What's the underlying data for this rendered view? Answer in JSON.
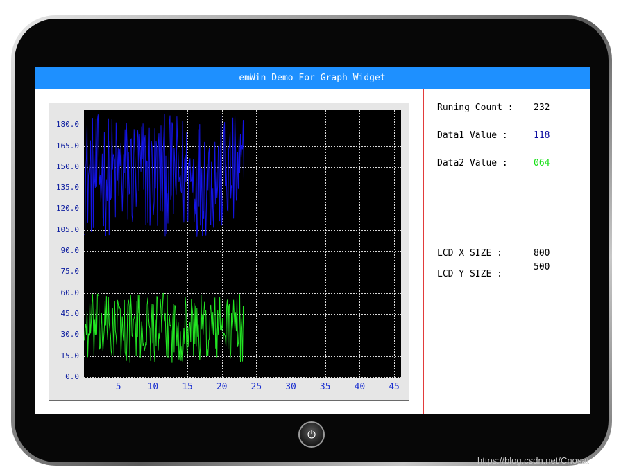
{
  "window": {
    "title": "emWin Demo For Graph Widget"
  },
  "info": {
    "running_count_label": "Runing Count :",
    "running_count_value": "232",
    "data1_label": "Data1 Value  :",
    "data1_value": "118",
    "data2_label": "Data2 Value  :",
    "data2_value": "064",
    "lcd_x_label": "LCD X SIZE :",
    "lcd_x_value": "800",
    "lcd_y_label": "LCD Y SIZE :",
    "lcd_y_value": "500"
  },
  "home_button": {
    "icon": "power-icon",
    "glyph": "⏻"
  },
  "watermark": "https://blog.csdn.net/Cnosat",
  "colors": {
    "title_bar": "#1e90ff",
    "series1": "#1414e6",
    "series2": "#23e623",
    "divider": "#e23b3b",
    "y_tick": "#1020a0",
    "x_tick": "#1a2fd0",
    "data1_value": "#0a0aa0",
    "data2_value": "#16e016"
  },
  "chart_data": {
    "type": "line",
    "x_ticks": [
      "5",
      "10",
      "15",
      "20",
      "25",
      "30",
      "35",
      "40",
      "45"
    ],
    "y_ticks": [
      "180.0",
      "165.0",
      "150.0",
      "135.0",
      "120.0",
      "105.0",
      "90.0",
      "75.0",
      "60.0",
      "45.0",
      "30.0",
      "15.0",
      "0.0"
    ],
    "ylim": [
      0,
      190
    ],
    "xlim": [
      0,
      46
    ],
    "grid": true,
    "series": [
      {
        "color": "#1414e6",
        "range": [
          100,
          188
        ],
        "points": 232
      },
      {
        "color": "#23e623",
        "range": [
          10,
          60
        ],
        "points": 232
      }
    ]
  }
}
